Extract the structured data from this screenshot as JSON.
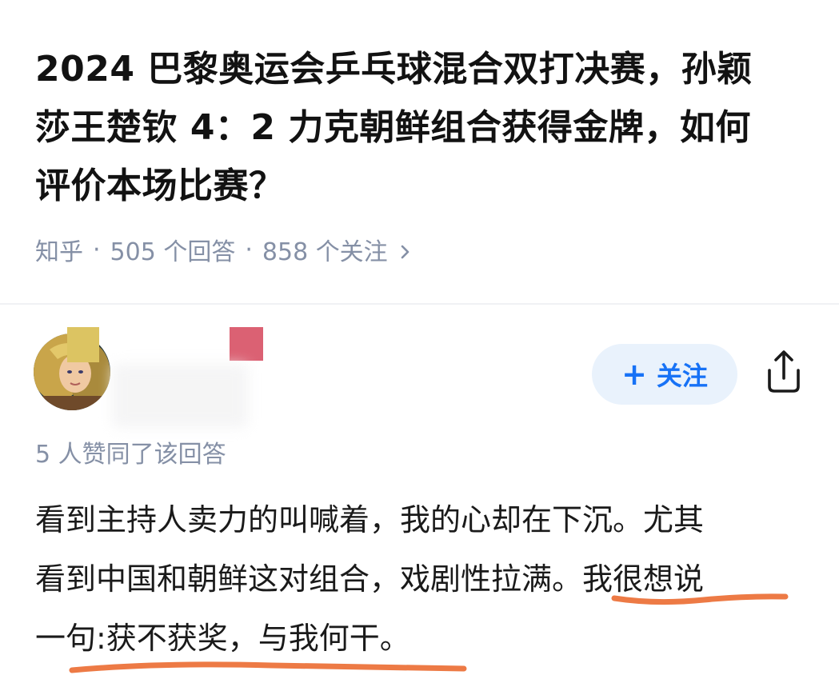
{
  "question": {
    "title_lines": [
      "2024 巴黎奥运会乒乓球混合双打决赛，孙颖",
      "莎王楚钦 4：2 力克朝鲜组合获得金牌，如何",
      "评价本场比赛？"
    ],
    "source": "知乎",
    "answer_count": "505 个回答",
    "follower_count": "858 个关注",
    "separator": "·"
  },
  "author": {
    "follow_label": "关注",
    "follow_prefix": "+"
  },
  "answer": {
    "upvote_note": "5 人赞同了该回答",
    "lines": [
      "看到主持人卖力的叫喊着，我的心却在下沉。尤其",
      "看到中国和朝鲜这对组合，戏剧性拉满。我很想说",
      "一句:获不获奖，与我何干。"
    ]
  },
  "colors": {
    "accent_blue": "#1772f6",
    "follow_bg": "#e9f2fc",
    "meta_gray": "#8590a6",
    "underline_orange": "#ed7a45",
    "mosaic_yellow": "#dcc462",
    "mosaic_pink": "#db6173"
  },
  "icons": {
    "chevron": "chevron-right-icon",
    "share": "share-icon",
    "plus": "plus-icon"
  }
}
